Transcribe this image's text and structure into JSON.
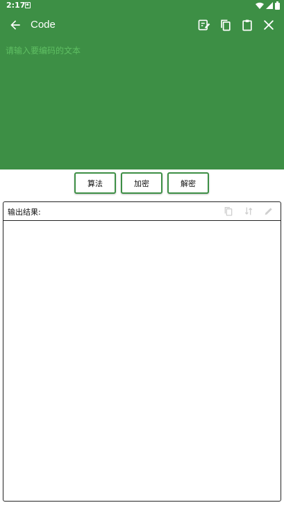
{
  "status_bar": {
    "time": "2:17"
  },
  "app_bar": {
    "title": "Code"
  },
  "input": {
    "placeholder": "请输入要编码的文本",
    "value": ""
  },
  "buttons": {
    "algorithm": "算法",
    "encrypt": "加密",
    "decrypt": "解密"
  },
  "output": {
    "label": "输出结果:",
    "value": ""
  },
  "icons": {
    "back": "arrow-back-icon",
    "edit": "edit-note-icon",
    "copy": "copy-icon",
    "paste": "clipboard-icon",
    "close": "close-icon",
    "out_copy": "copy-icon",
    "out_swap": "swap-vertical-icon",
    "out_edit": "pencil-icon"
  },
  "colors": {
    "primary": "#3d8f45",
    "placeholder": "#5fbf63",
    "disabled_icon": "#cfcfcf"
  }
}
